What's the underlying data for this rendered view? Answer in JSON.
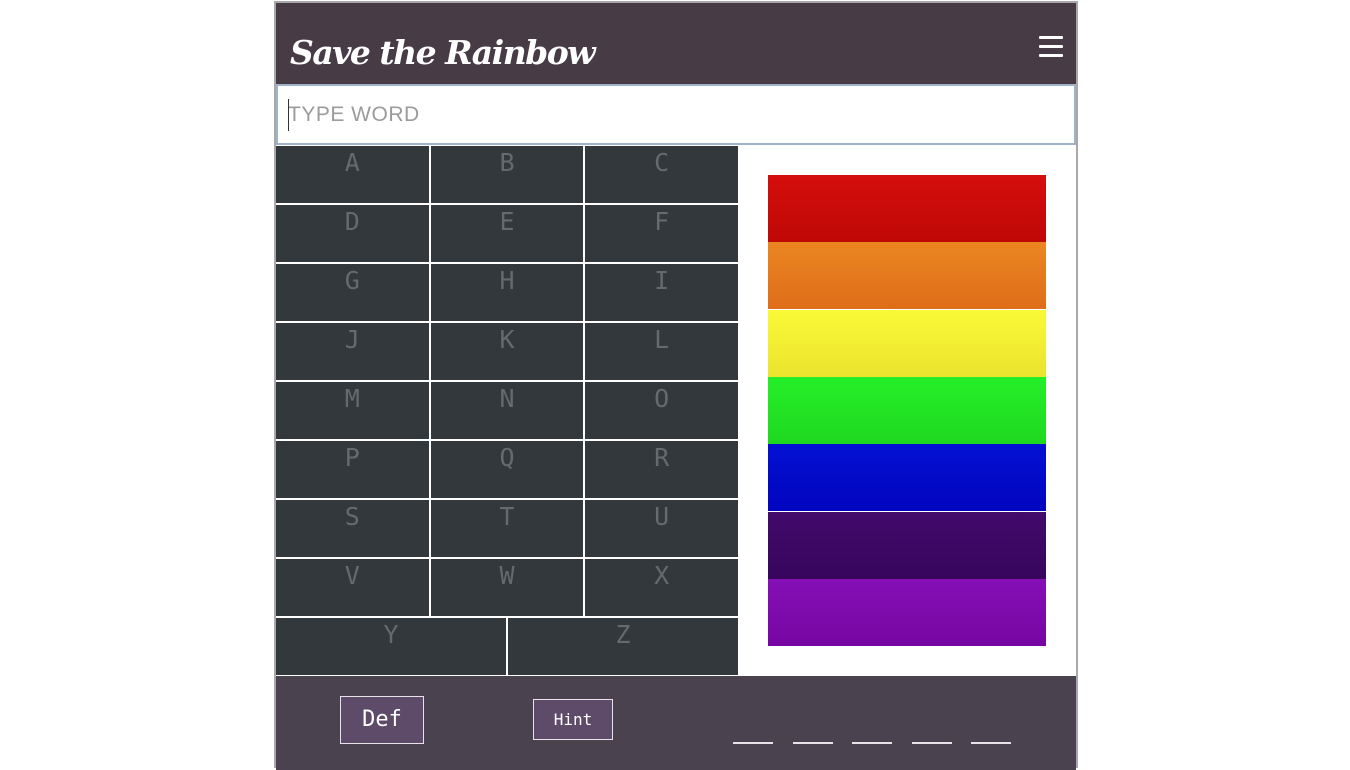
{
  "header": {
    "title": "Save the Rainbow",
    "menu_icon": "hamburger-menu-icon"
  },
  "input": {
    "placeholder": "TYPE WORD",
    "value": ""
  },
  "keyboard": {
    "rows": [
      [
        "A",
        "B",
        "C"
      ],
      [
        "D",
        "E",
        "F"
      ],
      [
        "G",
        "H",
        "I"
      ],
      [
        "J",
        "K",
        "L"
      ],
      [
        "M",
        "N",
        "O"
      ],
      [
        "P",
        "Q",
        "R"
      ],
      [
        "S",
        "T",
        "U"
      ],
      [
        "V",
        "W",
        "X"
      ],
      [
        "Y",
        "Z"
      ]
    ]
  },
  "rainbow": {
    "bands": [
      {
        "name": "red",
        "top": "#d40e0c",
        "bottom": "#bf0806"
      },
      {
        "name": "orange",
        "top": "#ea8622",
        "bottom": "#df6d18"
      },
      {
        "name": "yellow",
        "top": "#f9f936",
        "bottom": "#ebe32e"
      },
      {
        "name": "green",
        "top": "#25ef28",
        "bottom": "#1fd820"
      },
      {
        "name": "blue",
        "top": "#0310d2",
        "bottom": "#0205bf"
      },
      {
        "name": "indigo",
        "top": "#420a6b",
        "bottom": "#37055c"
      },
      {
        "name": "violet",
        "top": "#8510b6",
        "bottom": "#7606a2"
      }
    ]
  },
  "footer": {
    "def_label": "Def",
    "hint_label": "Hint",
    "word_blanks": [
      "",
      "",
      "",
      "",
      ""
    ]
  },
  "colors": {
    "header_bg": "#473b45",
    "footer_bg": "#4a424e",
    "key_bg": "#32383b",
    "key_text": "#656a6c",
    "button_bg": "#5d4b69"
  }
}
